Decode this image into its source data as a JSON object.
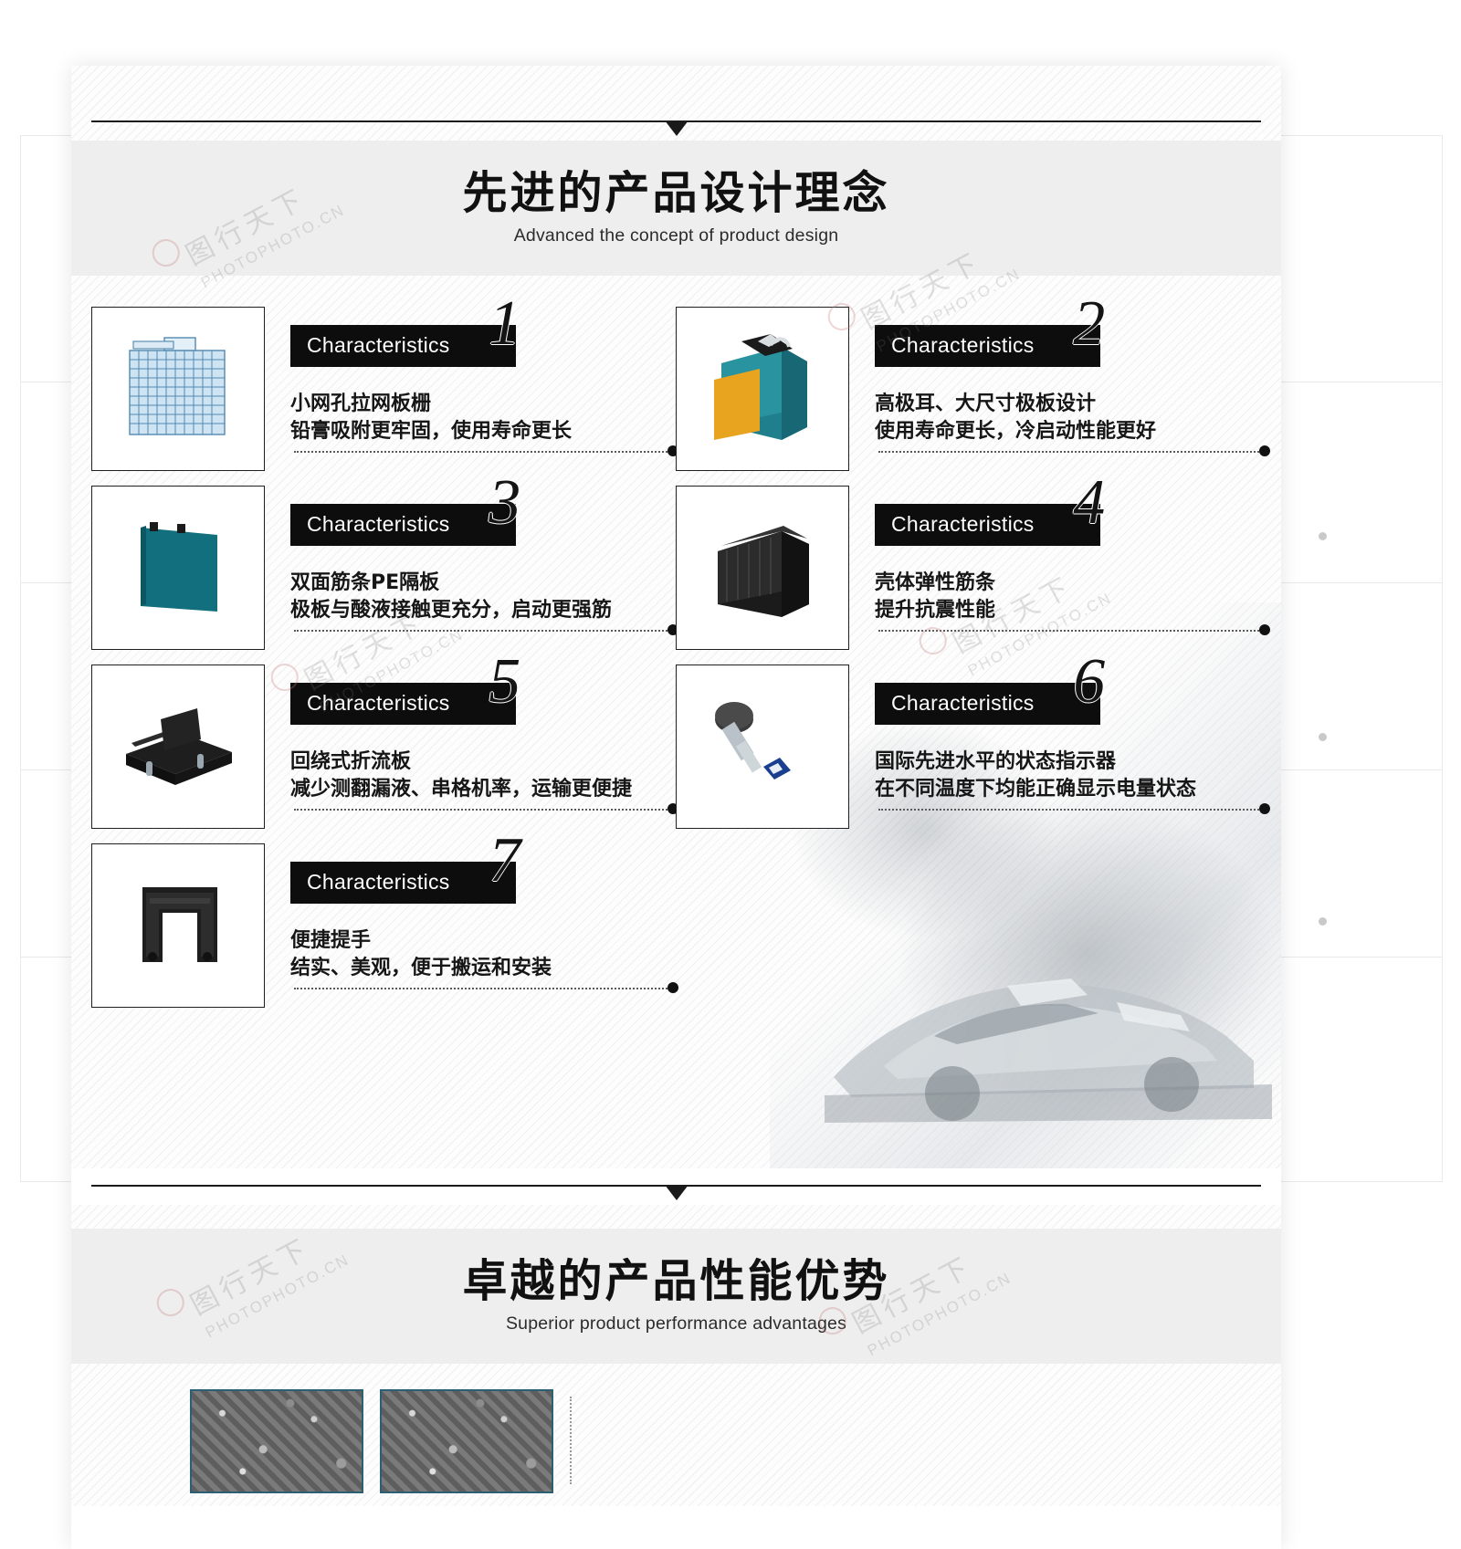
{
  "sections": {
    "design": {
      "title_cn": "先进的产品设计理念",
      "title_en": "Advanced the concept of product design"
    },
    "performance": {
      "title_cn": "卓越的产品性能优势",
      "title_en": "Superior product performance advantages"
    }
  },
  "chip_label": "Characteristics",
  "features": [
    {
      "number": "1",
      "chip": "Characteristics",
      "line1": "小网孔拉网板栅",
      "line2": "铅膏吸附更牢固，使用寿命更长",
      "icon": "mesh-grid-plate-image"
    },
    {
      "number": "2",
      "chip": "Characteristics",
      "line1": "高极耳、大尺寸极板设计",
      "line2": "使用寿命更长，冷启动性能更好",
      "icon": "high-tab-plate-image"
    },
    {
      "number": "3",
      "chip": "Characteristics",
      "line1": "双面筋条PE隔板",
      "line2": "极板与酸液接触更充分，启动更强筋",
      "icon": "pe-separator-image"
    },
    {
      "number": "4",
      "chip": "Characteristics",
      "line1": "壳体弹性筋条",
      "line2": "提升抗震性能",
      "icon": "battery-case-image"
    },
    {
      "number": "5",
      "chip": "Characteristics",
      "line1": "回绕式折流板",
      "line2": "减少测翻漏液、串格机率，运输更便捷",
      "icon": "baffle-plate-image"
    },
    {
      "number": "6",
      "chip": "Characteristics",
      "line1": "国际先进水平的状态指示器",
      "line2": "在不同温度下均能正确显示电量状态",
      "icon": "state-indicator-image"
    },
    {
      "number": "7",
      "chip": "Characteristics",
      "line1": "便捷提手",
      "line2": "结实、美观，便于搬运和安装",
      "icon": "carry-handle-image"
    }
  ],
  "watermarks": [
    "图行天下",
    "PHOTOPHOTO.CN"
  ],
  "colors": {
    "chip_bg": "#0d0d0d",
    "band_bg": "#eeeeee",
    "text": "#161616",
    "teal": "#1f7f8c",
    "gallery_border": "#2d5f73"
  }
}
